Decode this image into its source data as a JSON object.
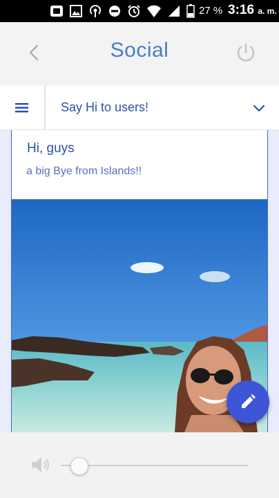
{
  "status_bar": {
    "battery_percent": "27 %",
    "time": "3:16",
    "time_suffix": "a. m."
  },
  "header": {
    "title": "Social",
    "back_icon": "chevron-left-icon",
    "power_icon": "power-icon"
  },
  "selector": {
    "menu_icon": "hamburger-menu-icon",
    "selected_value": "Say Hi to users!",
    "dropdown_icon": "chevron-down-icon"
  },
  "post": {
    "greeting": "Hi, guys",
    "message": "a big Bye from Islands!!"
  },
  "fab": {
    "icon": "pencil-icon"
  },
  "audio": {
    "volume_icon": "speaker-icon",
    "volume_level": 0.1
  },
  "colors": {
    "accent": "#3d55d6",
    "title_blue": "#4a7cc8",
    "text_blue": "#2c50a8"
  }
}
